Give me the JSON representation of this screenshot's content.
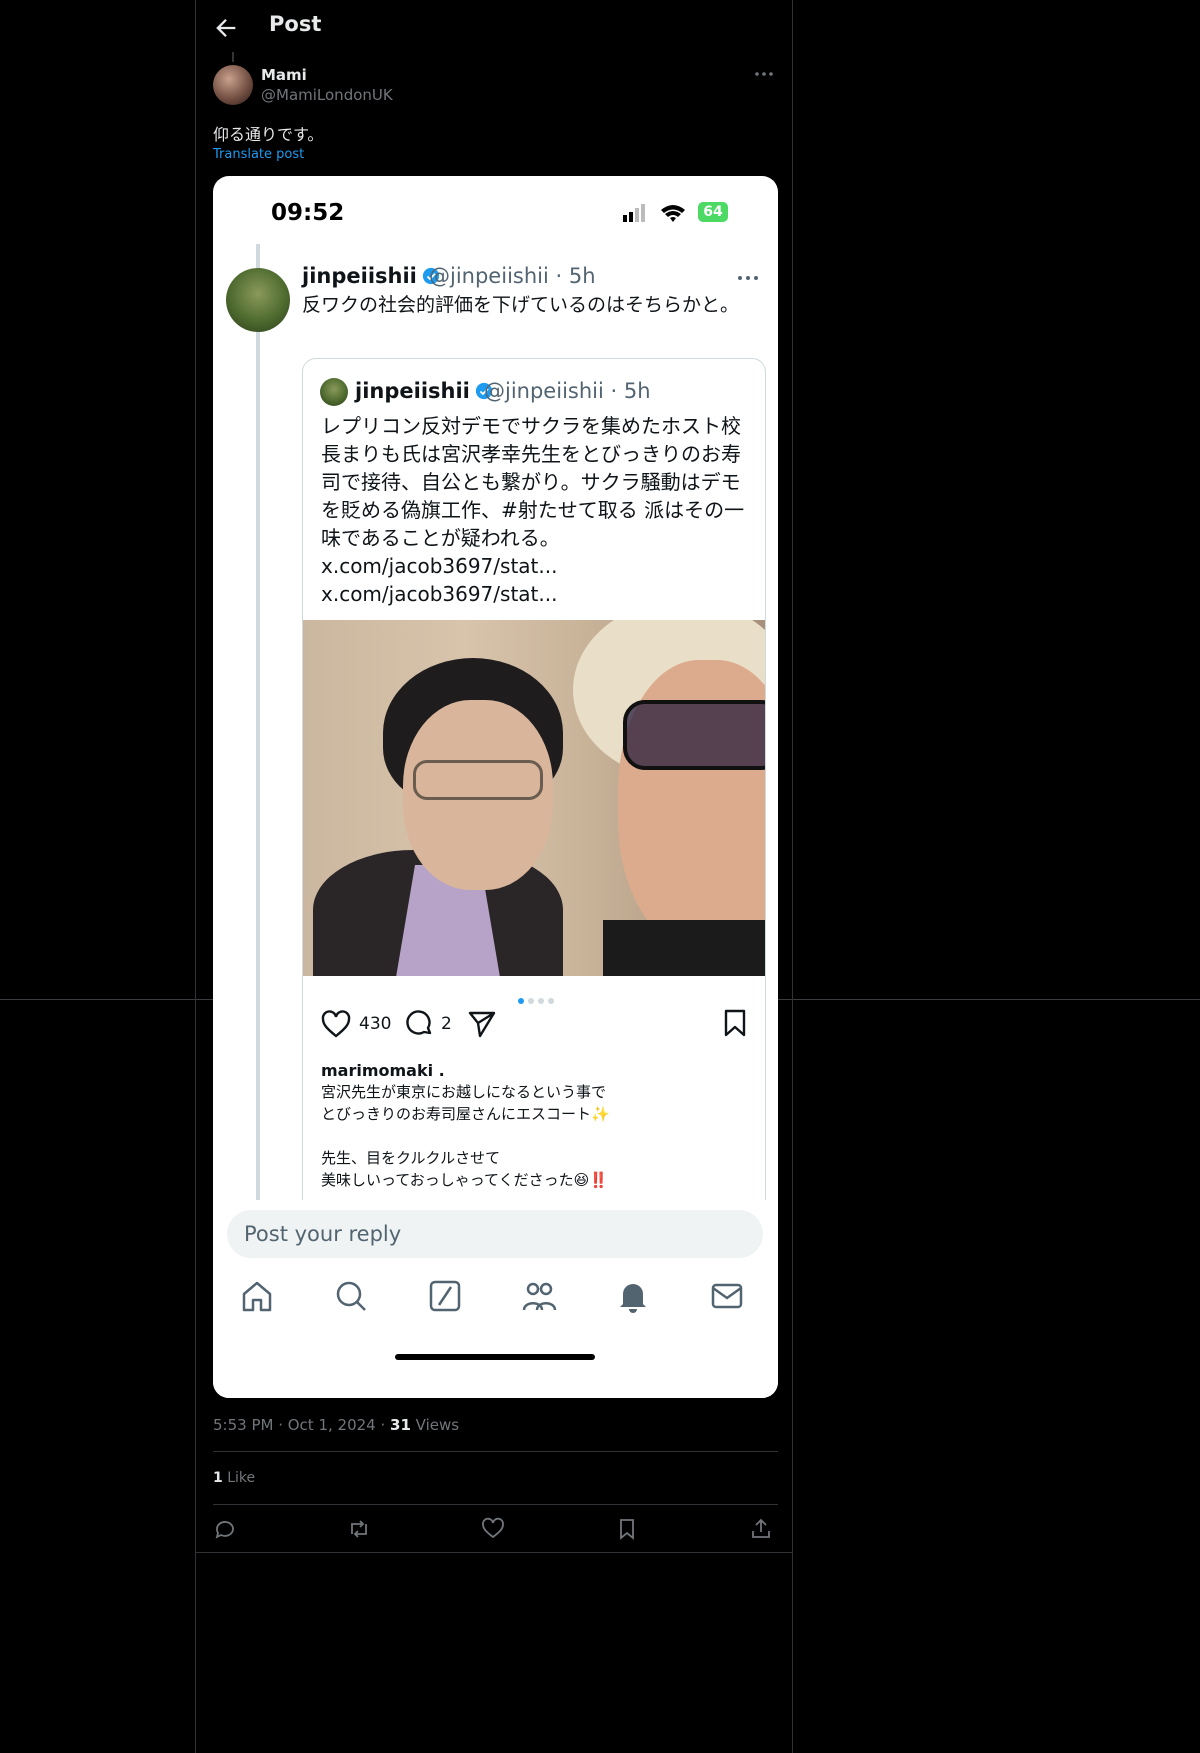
{
  "header": {
    "title": "Post"
  },
  "post": {
    "author_name": "Mami",
    "author_handle": "@MamiLondonUK",
    "text": "仰る通りです。",
    "translate_label": "Translate post",
    "timestamp": "5:53 PM · Oct 1, 2024 · ",
    "views_count": "31",
    "views_label": " Views",
    "likes_count": "1",
    "likes_label": " Like"
  },
  "embedded": {
    "status_time": "09:52",
    "battery": "64",
    "tweet": {
      "name": "jinpeiishii",
      "meta": "@jinpeiishii · 5h",
      "text": "反ワクの社会的評価を下げているのはそちらかと。"
    },
    "quote": {
      "name": "jinpeiishii",
      "meta": "@jinpeiishii · 5h",
      "text": "レプリコン反対デモでサクラを集めたホスト校長まりも氏は宮沢孝幸先生をとびっきりのお寿司で接待、自公とも繋がり。サクラ騒動はデモを貶める偽旗工作、#射たせて取る 派はその一味であることが疑われる。x.com/jacob3697/stat... x.com/jacob3697/stat...",
      "like_count": "430",
      "comment_count": "2",
      "ig_user": "marimomaki .",
      "caption": "宮沢先生が東京にお越しになるという事で\nとびっきりのお寿司屋さんにエスコート✨\n\n先生、目をクルクルさせて\n美味しいっておっしゃってくださった😆‼️"
    },
    "reply_placeholder": "Post your reply"
  },
  "colors": {
    "accent": "#1d9bf0",
    "background": "#000000",
    "muted": "#71767b"
  }
}
